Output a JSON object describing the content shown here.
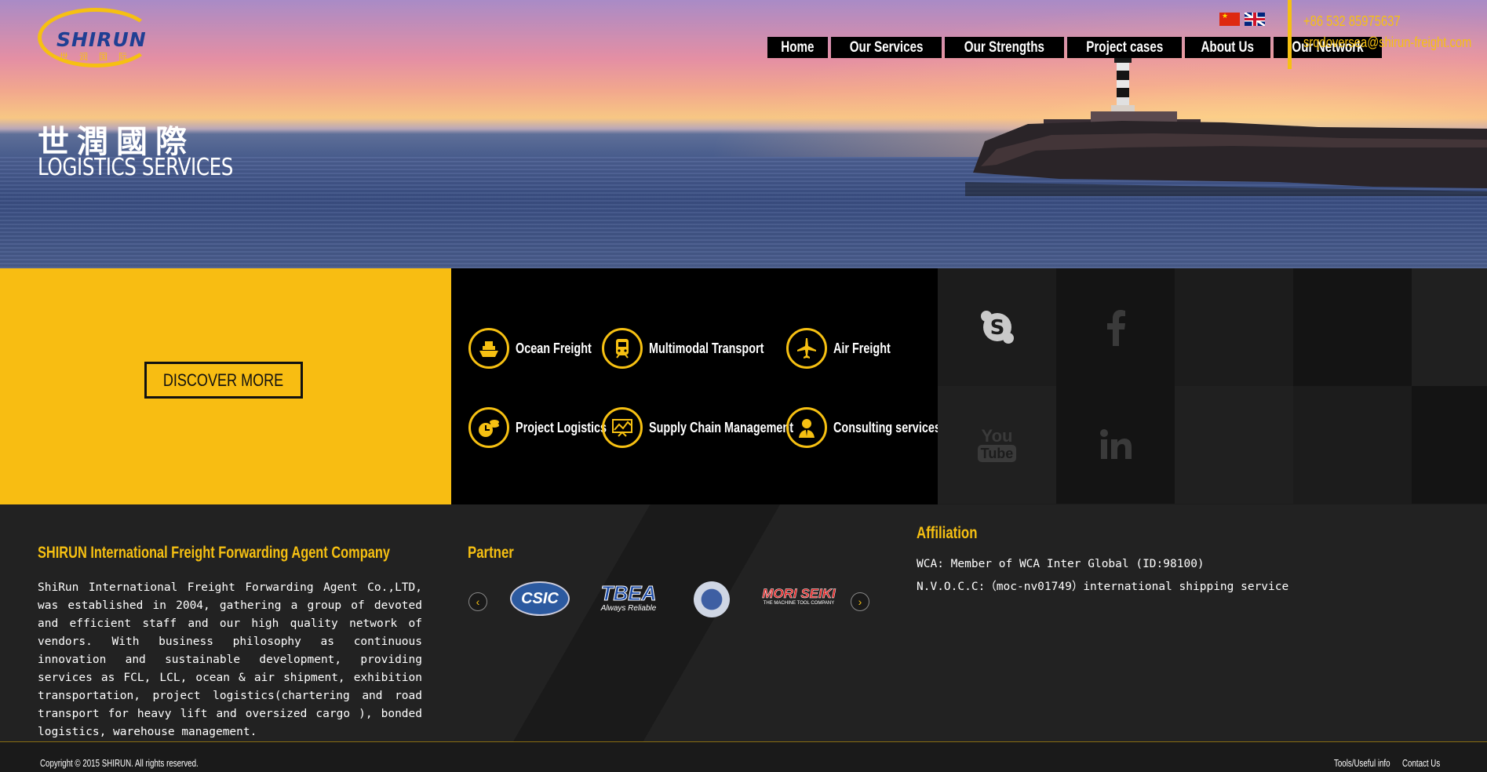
{
  "brand": {
    "logo_word": "SHIRUN",
    "logo_cn": "世润国际",
    "hero_cn": "世潤國際",
    "hero_en": "LOGISTICS SERVICES"
  },
  "header": {
    "flags": [
      {
        "name": "china-flag",
        "label": "Chinese"
      },
      {
        "name": "uk-flag",
        "label": "English"
      }
    ],
    "nav": [
      {
        "name": "home",
        "label": "Home"
      },
      {
        "name": "our-services",
        "label": "Our Services"
      },
      {
        "name": "our-strengths",
        "label": "Our Strengths"
      },
      {
        "name": "project-cases",
        "label": "Project cases"
      },
      {
        "name": "about-us",
        "label": "About Us"
      },
      {
        "name": "our-network",
        "label": "Our Network"
      }
    ],
    "phone": "+86 532 85975637",
    "email": "srqdoversea@shirun-freight.com"
  },
  "discover_label": "DISCOVER MORE",
  "services": [
    {
      "name": "ocean-freight",
      "label": "Ocean Freight",
      "icon": "ship-icon"
    },
    {
      "name": "multimodal-transport",
      "label": "Multimodal Transport",
      "icon": "train-icon"
    },
    {
      "name": "air-freight",
      "label": "Air Freight",
      "icon": "airplane-icon"
    },
    {
      "name": "project-logistics",
      "label": "Project Logistics",
      "icon": "clock-coins-icon"
    },
    {
      "name": "supply-chain",
      "label": "Supply Chain Management",
      "icon": "chart-icon"
    },
    {
      "name": "consulting",
      "label": "Consulting services",
      "icon": "consultant-icon"
    }
  ],
  "social": {
    "skype": "skype-icon",
    "facebook": "facebook-icon",
    "youtube_top": "You",
    "youtube_bottom": "Tube",
    "linkedin": "linkedin-icon"
  },
  "company": {
    "title": "SHIRUN International Freight Forwarding Agent Company",
    "text": "ShiRun International Freight Forwarding Agent Co.,LTD, was established in 2004, gathering a group of devoted and efficient staff and our high quality network of vendors. With business philosophy as continuous innovation and sustainable development, providing services as FCL, LCL, ocean & air shipment, exhibition transportation, project logistics(chartering and road transport for heavy lift and oversized cargo ), bonded logistics, warehouse management."
  },
  "partner": {
    "title": "Partner",
    "logos": [
      {
        "name": "csic-logo",
        "text": "CSIC"
      },
      {
        "name": "tbea-logo",
        "text": "TBEA",
        "sub": "Always Reliable"
      },
      {
        "name": "seal-logo",
        "text": ""
      },
      {
        "name": "mori-seiki-logo",
        "text": "MORI SEIKI",
        "sub": "THE MACHINE TOOL COMPANY"
      }
    ]
  },
  "affiliation": {
    "title": "Affiliation",
    "lines": [
      "WCA: Member of WCA Inter Global (ID:98100)",
      "N.V.O.C.C:（moc-nv01749）international shipping service"
    ]
  },
  "footer": {
    "copyright": "Copyright © 2015 SHIRUN. All rights reserved.",
    "links": [
      "Tools/Useful info",
      "Contact Us"
    ]
  },
  "colors": {
    "accent": "#f6c012",
    "yellow_panel": "#f8bd12",
    "dark": "#1a1a1a"
  }
}
